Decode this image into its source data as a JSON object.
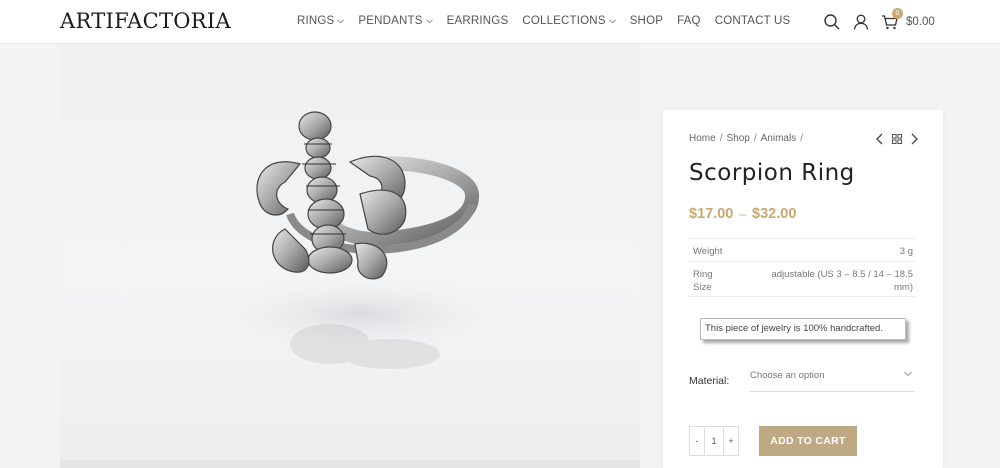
{
  "header": {
    "logo": "ARTIFACTORIA",
    "nav": [
      {
        "label": "RINGS",
        "dropdown": true
      },
      {
        "label": "PENDANTS",
        "dropdown": true
      },
      {
        "label": "EARRINGS",
        "dropdown": false
      },
      {
        "label": "COLLECTIONS",
        "dropdown": true
      },
      {
        "label": "SHOP",
        "dropdown": false
      },
      {
        "label": "FAQ",
        "dropdown": false
      },
      {
        "label": "CONTACT US",
        "dropdown": false
      }
    ],
    "cart_count": "0",
    "cart_total": "$0.00",
    "icons": [
      "search-icon",
      "user-icon",
      "cart-icon"
    ]
  },
  "product": {
    "breadcrumb": [
      "Home",
      "Shop",
      "Animals"
    ],
    "title": "Scorpion Ring",
    "price_min": "$17.00",
    "price_sep": "–",
    "price_max": "$32.00",
    "attributes": [
      {
        "label": "Weight",
        "value": "3 g"
      },
      {
        "label": "Ring Size",
        "value": "adjustable (US 3 – 8.5 / 14 – 18.5 mm)"
      }
    ],
    "handmade_note": "This piece of jewelry is 100% handcrafted.",
    "material_label": "Material:",
    "material_placeholder": "Choose an option",
    "quantity": "1",
    "qty_minus": "-",
    "qty_plus": "+",
    "add_to_cart": "ADD TO CART"
  },
  "colors": {
    "accent": "#c9a96e",
    "button": "#bfa884"
  }
}
